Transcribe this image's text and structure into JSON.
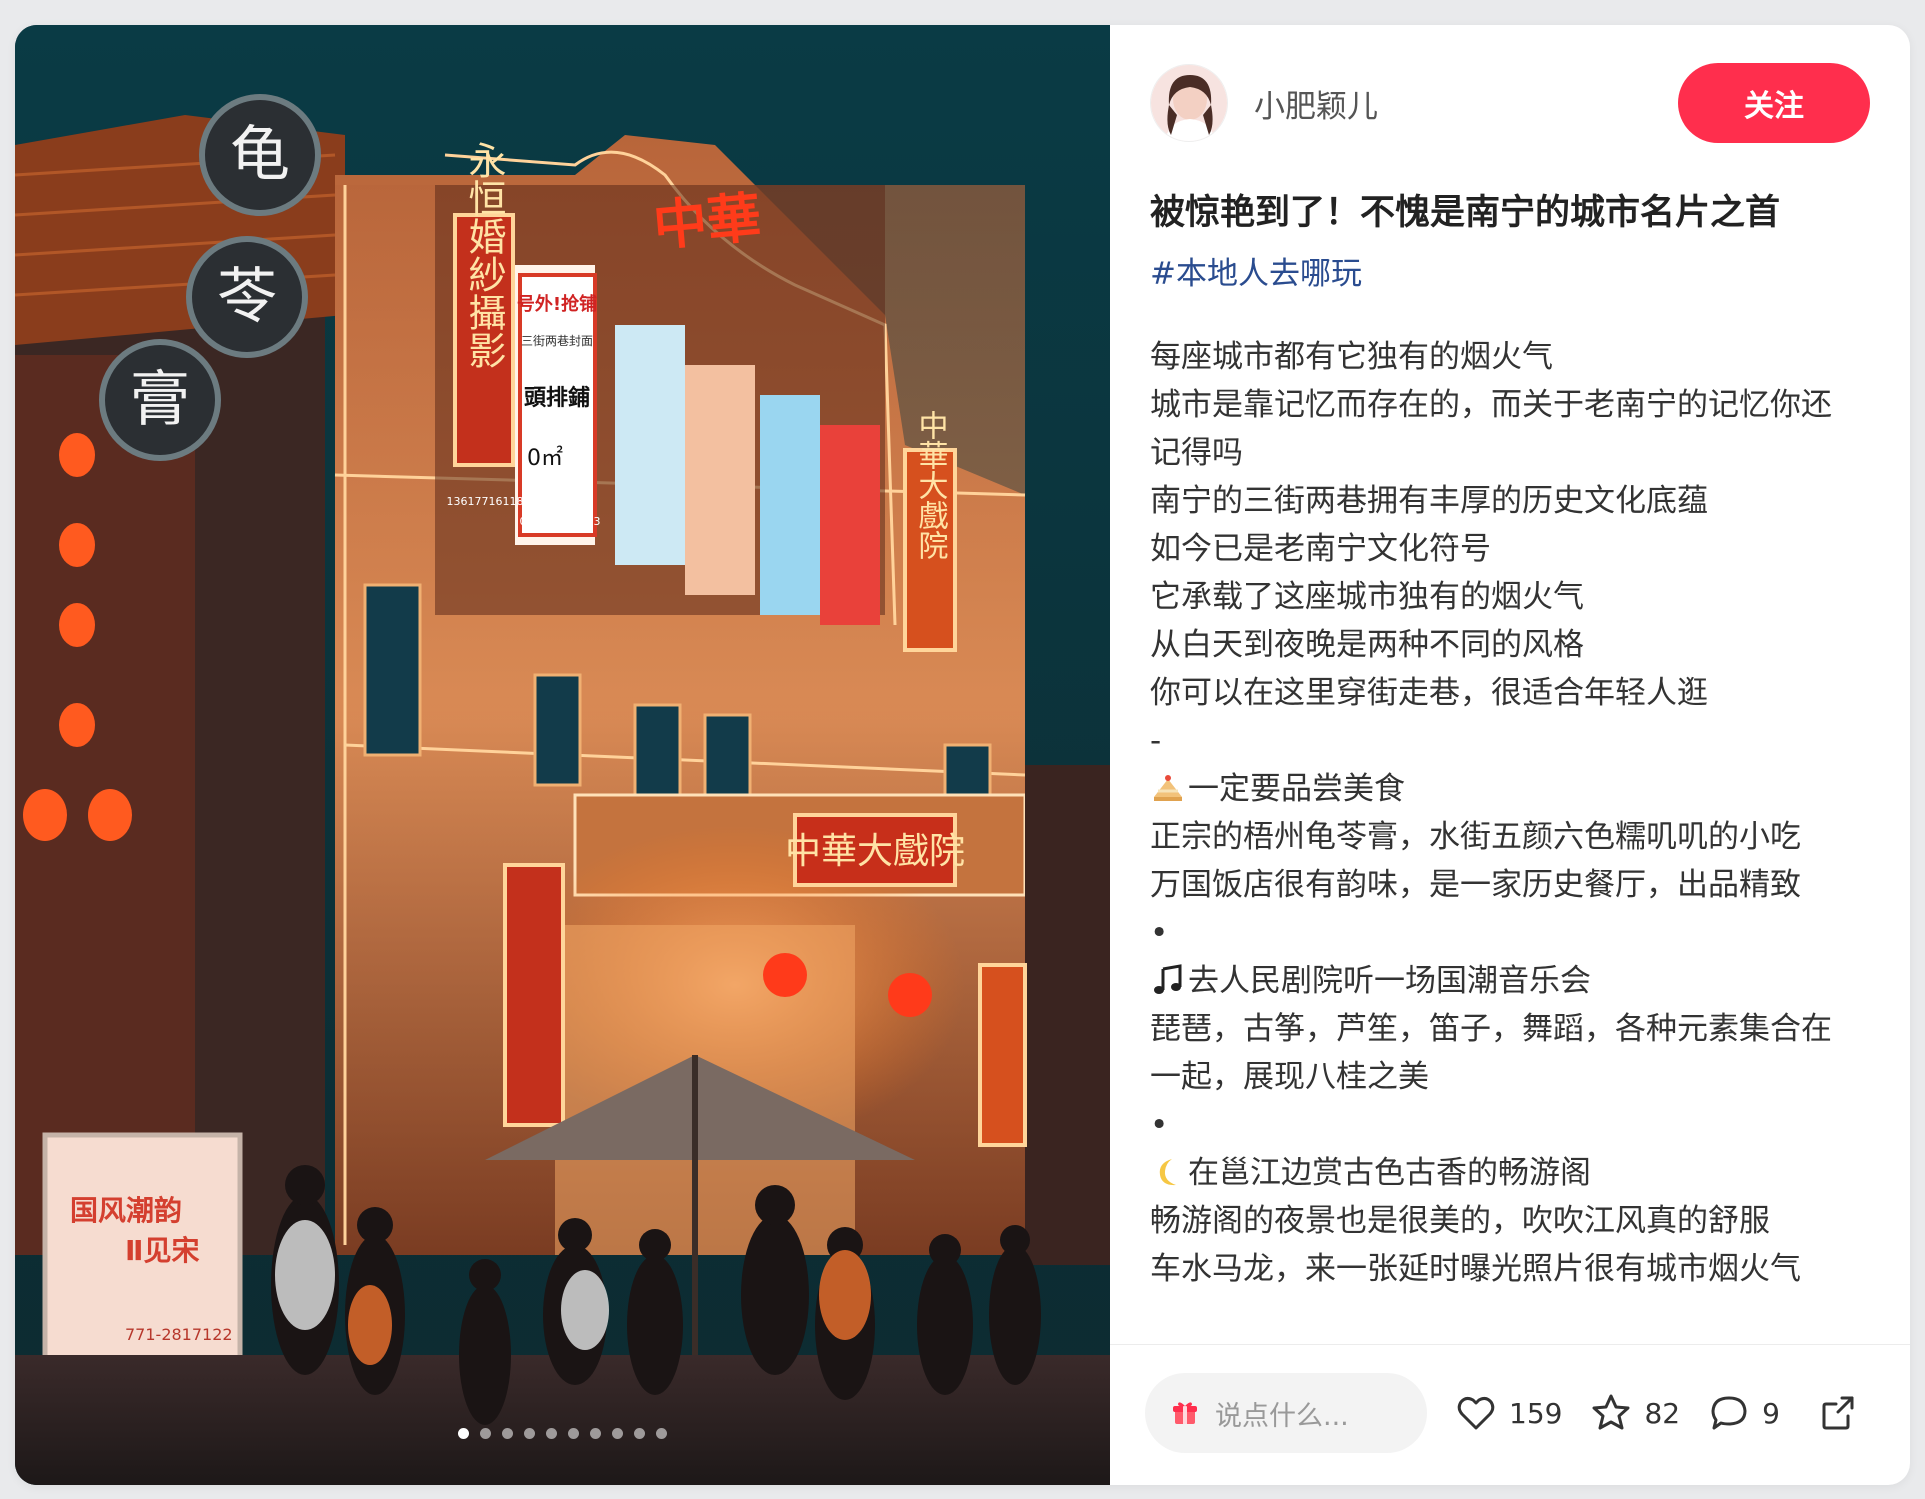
{
  "author": {
    "name": "小肥颖儿",
    "follow_label": "关注"
  },
  "post": {
    "title": "被惊艳到了！不愧是南宁的城市名片之首",
    "hashtag": "#本地人去哪玩",
    "lines": [
      {
        "text": "每座城市都有它独有的烟火气"
      },
      {
        "text": "城市是靠记忆而存在的，而关于老南宁的记忆你还"
      },
      {
        "text": "记得吗"
      },
      {
        "text": "南宁的三街两巷拥有丰厚的历史文化底蕴"
      },
      {
        "text": "如今已是老南宁文化符号"
      },
      {
        "text": "它承载了这座城市独有的烟火气"
      },
      {
        "text": "从白天到夜晚是两种不同的风格"
      },
      {
        "text": "你可以在这里穿街走巷，很适合年轻人逛"
      },
      {
        "text": "-"
      },
      {
        "icon": "cake-icon",
        "text": "一定要品尝美食"
      },
      {
        "text": "正宗的梧州龟苓膏，水街五颜六色糯叽叽的小吃"
      },
      {
        "text": "万国饭店很有韵味，是一家历史餐厅，出品精致"
      },
      {
        "text": "•"
      },
      {
        "icon": "music-note-icon",
        "text": "去人民剧院听一场国潮音乐会"
      },
      {
        "text": "琵琶，古筝，芦笙，笛子，舞蹈，各种元素集合在"
      },
      {
        "text": "一起，展现八桂之美"
      },
      {
        "text": "•"
      },
      {
        "icon": "moon-icon",
        "text": "在邕江边赏古色古香的畅游阁"
      },
      {
        "text": "畅游阁的夜景也是很美的，吹吹江风真的舒服"
      },
      {
        "text": "车水马龙，来一张延时曝光照片很有城市烟火气"
      }
    ]
  },
  "footer": {
    "comment_placeholder": "说点什么...",
    "likes": "159",
    "favorites": "82",
    "comments": "9"
  },
  "carousel": {
    "total": 10,
    "active_index": 0
  },
  "photo_signs": {
    "round_signs": [
      "龟",
      "苓",
      "膏"
    ],
    "rooftop": "中華",
    "vertical_left": "永恒婚紗攝影",
    "vertical_right": "中華大戲院",
    "balcony": "中華大戲院",
    "poster_headline": "号外!抢铺",
    "poster_sub": "三街两巷封面",
    "poster_big": "頭排鋪",
    "poster_area": "0㎡",
    "poster_phone_1": "13617716118",
    "poster_phone_2": "0771-4877773",
    "banner_title": "国风潮韵",
    "banner_sub": "Ⅱ见宋",
    "banner_phone": "771-2817122"
  },
  "colors": {
    "accent": "#ff2e4d",
    "hashtag": "#2a4c8f",
    "neon": "#ff7a1a"
  }
}
